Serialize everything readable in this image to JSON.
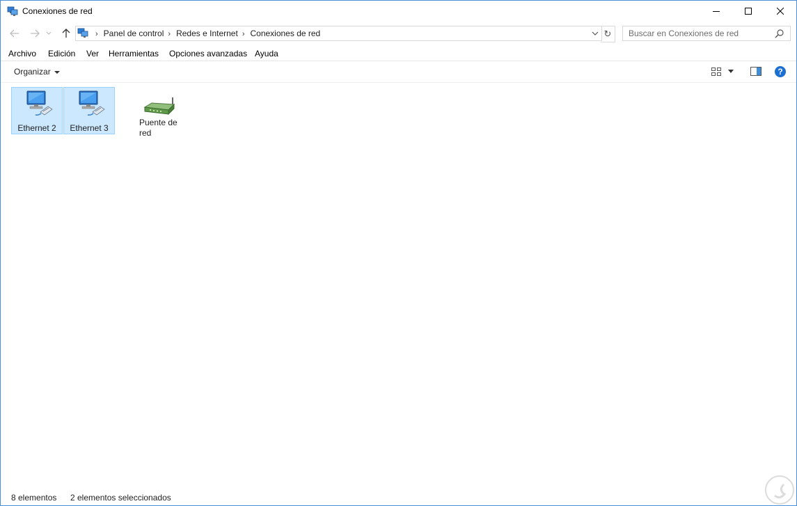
{
  "window": {
    "title": "Conexiones de red",
    "icon": "network-connections-icon"
  },
  "address": {
    "breadcrumbs": [
      "Panel de control",
      "Redes e Internet",
      "Conexiones de red"
    ],
    "search_placeholder": "Buscar en Conexiones de red"
  },
  "menu": {
    "items": [
      "Archivo",
      "Edición",
      "Ver",
      "Herramientas",
      "Opciones avanzadas",
      "Ayuda"
    ]
  },
  "commandbar": {
    "organize_label": "Organizar",
    "help_label": "?"
  },
  "items": [
    {
      "label": "Ethernet 2",
      "icon": "ethernet-adapter-icon",
      "selected": true
    },
    {
      "label": "Ethernet 3",
      "icon": "ethernet-adapter-icon",
      "selected": true
    },
    {
      "label": "Puente de red",
      "icon": "network-bridge-icon",
      "selected": false
    }
  ],
  "status": {
    "count": "8 elementos",
    "selected": "2 elementos seleccionados"
  },
  "colors": {
    "selection_bg": "#cce8ff",
    "selection_border": "#99d1ff",
    "help_blue": "#1a6fd1"
  }
}
